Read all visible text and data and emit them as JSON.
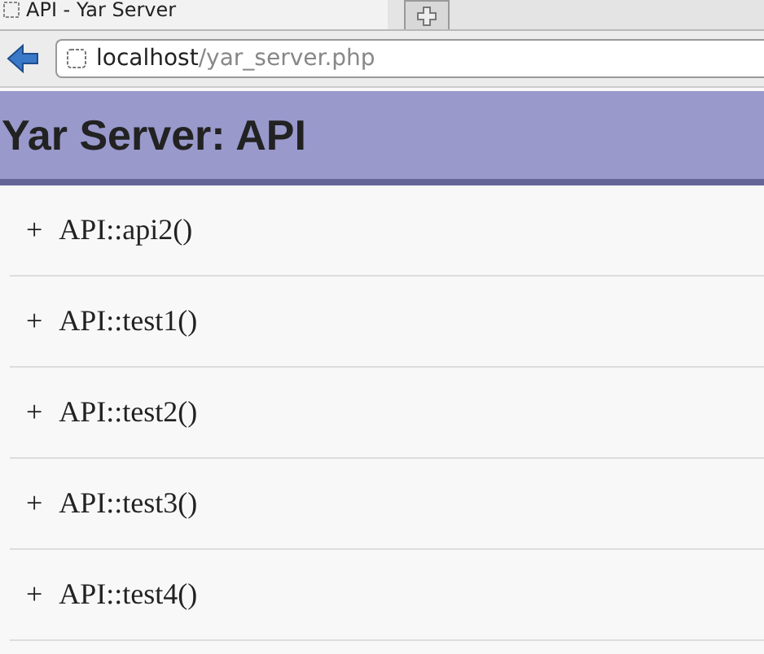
{
  "browser": {
    "tab_title": "API - Yar Server",
    "address_host": "localhost",
    "address_path": "/yar_server.php"
  },
  "page": {
    "title": "Yar Server: API",
    "methods": [
      {
        "marker": "+",
        "name": "API::api2()"
      },
      {
        "marker": "+",
        "name": "API::test1()"
      },
      {
        "marker": "+",
        "name": "API::test2()"
      },
      {
        "marker": "+",
        "name": "API::test3()"
      },
      {
        "marker": "+",
        "name": "API::test4()"
      }
    ]
  }
}
